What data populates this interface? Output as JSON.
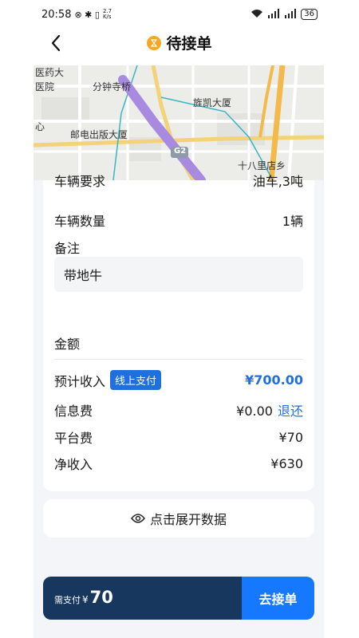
{
  "status_bar": {
    "time": "20:58",
    "net_speed": "2.7 K/s",
    "battery": "36"
  },
  "header": {
    "title": "待接单"
  },
  "map": {
    "labels": [
      "医药大",
      "医院",
      "分钟寺桥",
      "旌凯大厦",
      "心",
      "邮电出版大厦",
      "G2",
      "十八里店乡"
    ]
  },
  "order_info": {
    "partial_row_label": "车辆要求",
    "partial_row_value": "油车,3吨",
    "vehicle_count_label": "车辆数量",
    "vehicle_count_value": "1辆",
    "remark_label": "备注",
    "remark_value": "带地牛"
  },
  "amount": {
    "section_title": "金额",
    "estimated_income_label": "预计收入",
    "payment_badge": "线上支付",
    "estimated_income_value": "¥700.00",
    "info_fee_label": "信息费",
    "info_fee_value": "¥0.00",
    "info_fee_action": "退还",
    "platform_fee_label": "平台费",
    "platform_fee_value": "¥70",
    "net_income_label": "净收入",
    "net_income_value": "¥630"
  },
  "expand": {
    "label": "点击展开数据"
  },
  "bottom_bar": {
    "need_pay_label": "需支付",
    "currency": "¥",
    "amount": "70",
    "accept_button": "去接单"
  },
  "colors": {
    "accent": "#1f6fdc",
    "accept_button": "#1677ff",
    "pay_bar": "#17375e",
    "route": "#a88be0",
    "highway": "#f3b94a"
  }
}
